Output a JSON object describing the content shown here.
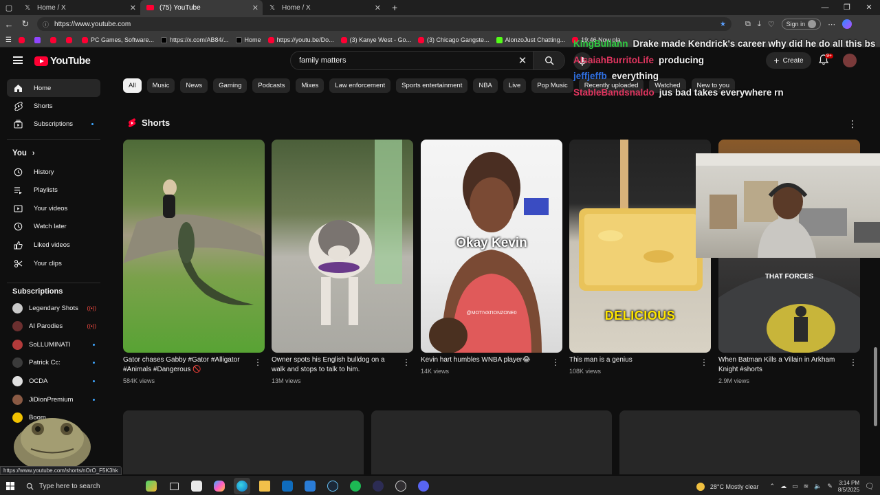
{
  "browser": {
    "tabs": [
      {
        "label": "Home / X",
        "icon": "x-logo-icon"
      },
      {
        "label": "(75) YouTube",
        "icon": "youtube-icon",
        "active": true
      },
      {
        "label": "Home / X",
        "icon": "x-logo-icon"
      }
    ],
    "new_tab": "+",
    "url": "https://www.youtube.com",
    "sign_in": "Sign in",
    "bookmarks": [
      {
        "label": "",
        "type": "yt"
      },
      {
        "label": "",
        "type": "purple"
      },
      {
        "label": "",
        "type": "yt"
      },
      {
        "label": "",
        "type": "yt"
      },
      {
        "label": "PC Games, Software...",
        "type": "yt"
      },
      {
        "label": "https://x.com/AB84/...",
        "type": "x"
      },
      {
        "label": "Home",
        "type": "x"
      },
      {
        "label": "https://youtu.be/Do...",
        "type": "yt"
      },
      {
        "label": "(3) Kanye West - Go...",
        "type": "yt"
      },
      {
        "label": "(3) Chicago Gangste...",
        "type": "yt"
      },
      {
        "label": "AlonzoJust Chatting...",
        "type": "green"
      },
      {
        "label": "19:46 Now pla",
        "type": "yt"
      }
    ]
  },
  "youtube": {
    "logo_text": "YouTube",
    "search_query": "family matters",
    "create_label": "Create",
    "notif_badge": "9+",
    "chips": [
      "All",
      "Music",
      "News",
      "Gaming",
      "Podcasts",
      "Mixes",
      "Law enforcement",
      "Sports entertainment",
      "NBA",
      "Live",
      "Pop Music",
      "Recently uploaded",
      "Watched",
      "New to you"
    ],
    "sidebar": {
      "main": [
        {
          "label": "Home",
          "icon": "home-icon"
        },
        {
          "label": "Shorts",
          "icon": "shorts-icon"
        },
        {
          "label": "Subscriptions",
          "icon": "subscriptions-icon"
        }
      ],
      "you_heading": "You",
      "you_items": [
        {
          "label": "History",
          "icon": "history-icon"
        },
        {
          "label": "Playlists",
          "icon": "playlists-icon"
        },
        {
          "label": "Your videos",
          "icon": "your-videos-icon"
        },
        {
          "label": "Watch later",
          "icon": "watch-later-icon"
        },
        {
          "label": "Liked videos",
          "icon": "liked-videos-icon"
        },
        {
          "label": "Your clips",
          "icon": "clips-icon"
        }
      ],
      "subscriptions_heading": "Subscriptions",
      "subscriptions": [
        {
          "label": "Legendary Shots",
          "color": "#c9c9c9",
          "status": "live"
        },
        {
          "label": "AI Parodies",
          "color": "#6b2f2f",
          "status": "live"
        },
        {
          "label": "SoLLUMINATI",
          "color": "#b33b3b",
          "status": "dot"
        },
        {
          "label": "Patrick Cc:",
          "color": "#3b3b3b",
          "status": "dot"
        },
        {
          "label": "OCDA",
          "color": "#e0e0e0",
          "status": "dot"
        },
        {
          "label": "JiDionPremium",
          "color": "#8a5a44",
          "status": "dot"
        },
        {
          "label": "Boom...",
          "color": "#f2c200",
          "status": "none"
        }
      ]
    },
    "shorts": {
      "title": "Shorts",
      "items": [
        {
          "title": "Gator chases Gabby #Gator #Alligator #Animals #Dangerous 🚫",
          "views": "584K views",
          "overlay": ""
        },
        {
          "title": "Owner spots his English bulldog on a walk and stops to talk to him.",
          "views": "13M views",
          "overlay": ""
        },
        {
          "title": "Kevin hart humbles WNBA player😂",
          "views": "14K views",
          "overlay": "Okay Kevin",
          "watermark": "@MOTIVATIONZONE0"
        },
        {
          "title": "This man is a genius",
          "views": "108K views",
          "overlay": "DELICIOUS"
        },
        {
          "title": "When Batman Kills a Villain in Arkham Knight #shorts",
          "views": "2.9M views",
          "overlay": "THAT FORCES"
        }
      ]
    }
  },
  "chat": [
    {
      "user": "KingBullann",
      "message": "Drake made Kendrick's career why did he do all this bs",
      "color": "#2ecc40"
    },
    {
      "user": "AIsaiahBurritoLife",
      "message": "producing",
      "color": "#e0355f"
    },
    {
      "user": "jeffjeffb",
      "message": "everything",
      "color": "#2f6fe0"
    },
    {
      "user": "StableBandsnaldo",
      "message": "jus bad takes everywhere rn",
      "color": "#e0355f"
    }
  ],
  "status_url": "https://www.youtube.com/shorts/nOrO_F5K3hk",
  "taskbar": {
    "search_placeholder": "Type here to search",
    "weather": "28°C  Mostly clear",
    "time": "3:14 PM",
    "date": "8/5/2025"
  },
  "colors": {
    "accent": "#ff0033",
    "background": "#0f0f0f",
    "chip_bg": "#272727",
    "link_blue": "#3ea6ff"
  }
}
